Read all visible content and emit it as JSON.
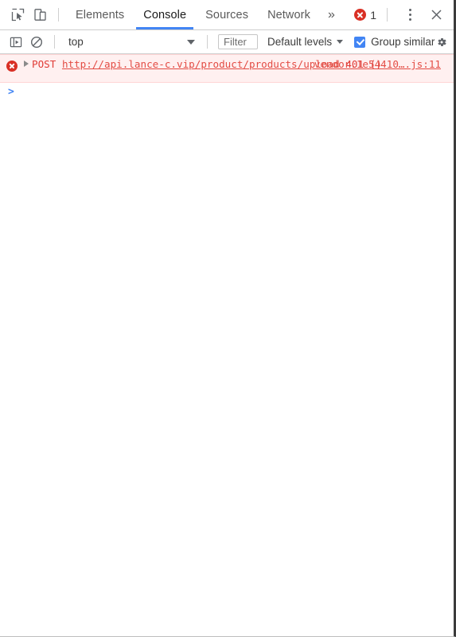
{
  "tabbar": {
    "inspect_icon": "inspect-element-icon",
    "device_icon": "device-toolbar-icon",
    "tabs": [
      {
        "label": "Elements",
        "selected": false
      },
      {
        "label": "Console",
        "selected": true
      },
      {
        "label": "Sources",
        "selected": false
      },
      {
        "label": "Network",
        "selected": false
      }
    ],
    "more_tabs_label": "»",
    "error_count": "1",
    "error_icon": "error-circle-icon",
    "menu_icon": "more-options-icon",
    "close_icon": "close-icon"
  },
  "console_toolbar": {
    "sidebar_icon": "console-sidebar-icon",
    "clear_icon": "clear-console-icon",
    "context": "top",
    "filter_placeholder": "Filter",
    "filter_value": "",
    "levels_label": "Default levels",
    "group_similar_label": "Group similar",
    "group_similar_checked": true,
    "settings_icon": "settings-gear-icon"
  },
  "console_messages": [
    {
      "type": "error",
      "icon": "error-circle-icon",
      "expandable": true,
      "method": "POST",
      "url": "http://api.lance-c.vip/product/products/upload",
      "status": "401",
      "parens": "()",
      "source": "vendor.1e54410….js:11"
    }
  ],
  "prompt": {
    "caret": ">",
    "value": ""
  },
  "colors": {
    "accent": "#4285f4",
    "error": "#d93025",
    "error_text": "#e03b36",
    "error_bg": "#fff0f0",
    "error_border": "#ffd6d6"
  }
}
